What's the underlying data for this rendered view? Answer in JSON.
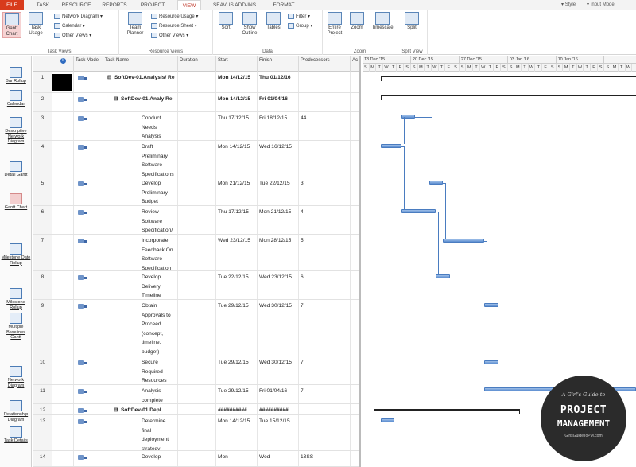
{
  "ribbon": {
    "tabs": [
      "FILE",
      "TASK",
      "RESOURCE",
      "REPORTS",
      "PROJECT",
      "VIEW",
      "SEAVUS ADD-INS",
      "FORMAT"
    ],
    "right": {
      "style": "Style",
      "input_mode": "Input Mode"
    },
    "task_views": {
      "label": "Task Views",
      "gantt": "Gantt Chart",
      "usage": "Task Usage",
      "network": "Network Diagram",
      "calendar": "Calendar",
      "other": "Other Views"
    },
    "resource_views": {
      "label": "Resource Views",
      "team": "Team Planner",
      "usage": "Resource Usage",
      "sheet": "Resource Sheet",
      "other": "Other Views"
    },
    "data": {
      "label": "Data",
      "sort": "Sort",
      "outline": "Show Outline",
      "tables": "Tables",
      "filter": "Filter",
      "group": "Group"
    },
    "zoom": {
      "label": "Zoom",
      "entire": "Entire Project",
      "zoom": "Zoom",
      "timescale": "Timescale"
    },
    "split": {
      "label": "Split View",
      "split": "Split"
    }
  },
  "viewbar": [
    {
      "label": "Bar Rollup",
      "icon": "bar-rollup-icon",
      "selected": false
    },
    {
      "label": "Calendar",
      "icon": "calendar-icon",
      "selected": false
    },
    {
      "label": "Descriptive Network Diagram",
      "icon": "network-diagram-icon",
      "selected": false
    },
    {
      "label": "Detail Gantt",
      "icon": "detail-gantt-icon",
      "selected": false
    },
    {
      "label": "Gantt Chart",
      "icon": "gantt-chart-icon",
      "selected": true
    },
    {
      "label": "Milestone Date Rollup",
      "icon": "milestone-date-icon",
      "selected": false
    },
    {
      "label": "Milestone Rollup",
      "icon": "milestone-rollup-icon",
      "selected": false
    },
    {
      "label": "Multiple Baselines Gantt",
      "icon": "baselines-gantt-icon",
      "selected": false
    },
    {
      "label": "Network Diagram",
      "icon": "network-icon",
      "selected": false
    },
    {
      "label": "Relationship Diagram",
      "icon": "relationship-icon",
      "selected": false
    },
    {
      "label": "Task Details",
      "icon": "task-details-icon",
      "selected": false
    }
  ],
  "table": {
    "columns": [
      "",
      "Task Mode",
      "Task Name",
      "Duration",
      "Start",
      "Finish",
      "Predecessors",
      "Ac"
    ],
    "rows": [
      {
        "id": "1",
        "name": "SoftDev-01.Analysis/ Re",
        "duration": "",
        "start": "Mon 14/12/15",
        "finish": "Thu 01/12/16",
        "pred": "",
        "level": 0,
        "summary": true
      },
      {
        "id": "2",
        "name": "SoftDev-01.Analy Re",
        "duration": "",
        "start": "Mon 14/12/15",
        "finish": "Fri 01/04/16",
        "pred": "",
        "level": 1,
        "summary": true
      },
      {
        "id": "3",
        "name": "Conduct Needs Analysis",
        "duration": "",
        "start": "Thu 17/12/15",
        "finish": "Fri 18/12/15",
        "pred": "44",
        "level": 2,
        "summary": false
      },
      {
        "id": "4",
        "name": "Draft Preliminary Software Specifications",
        "duration": "",
        "start": "Mon 14/12/15",
        "finish": "Wed 16/12/15",
        "pred": "",
        "level": 2,
        "summary": false
      },
      {
        "id": "5",
        "name": "Develop Preliminary Budget",
        "duration": "",
        "start": "Mon 21/12/15",
        "finish": "Tue 22/12/15",
        "pred": "3",
        "level": 2,
        "summary": false
      },
      {
        "id": "6",
        "name": "Review Software Specification/",
        "duration": "",
        "start": "Thu 17/12/15",
        "finish": "Mon 21/12/15",
        "pred": "4",
        "level": 2,
        "summary": false
      },
      {
        "id": "7",
        "name": "Incorporate Feedback On Software Specification",
        "duration": "",
        "start": "Wed 23/12/15",
        "finish": "Mon 28/12/15",
        "pred": "5",
        "level": 2,
        "summary": false
      },
      {
        "id": "8",
        "name": "Develop Delivery Timeline",
        "duration": "",
        "start": "Tue 22/12/15",
        "finish": "Wed 23/12/15",
        "pred": "6",
        "level": 2,
        "summary": false
      },
      {
        "id": "9",
        "name": "Obtain Approvals to Proceed (concept, timeline, budget)",
        "duration": "",
        "start": "Tue 29/12/15",
        "finish": "Wed 30/12/15",
        "pred": "7",
        "level": 2,
        "summary": false
      },
      {
        "id": "10",
        "name": "Secure Required Resources",
        "duration": "",
        "start": "Tue 29/12/15",
        "finish": "Wed 30/12/15",
        "pred": "7",
        "level": 2,
        "summary": false
      },
      {
        "id": "11",
        "name": "Analysis complete",
        "duration": "",
        "start": "Tue 29/12/15",
        "finish": "Fri 01/04/16",
        "pred": "7",
        "level": 2,
        "summary": false
      },
      {
        "id": "12",
        "name": "SoftDev-01.Depl",
        "duration": "",
        "start": "##########",
        "finish": "##########",
        "pred": "",
        "level": 1,
        "summary": true
      },
      {
        "id": "13",
        "name": "Determine final deployment strategy",
        "duration": "",
        "start": "Mon 14/12/15",
        "finish": "Tue 15/12/15",
        "pred": "",
        "level": 2,
        "summary": false
      },
      {
        "id": "14",
        "name": "Develop",
        "duration": "",
        "start": "Mon",
        "finish": "Wed",
        "pred": "13SS",
        "level": 2,
        "summary": false
      }
    ]
  },
  "gantt": {
    "weeks": [
      "13 Dec '15",
      "20 Dec '15",
      "27 Dec '15",
      "03 Jan '16",
      "10 Jan '16"
    ],
    "days": [
      "S",
      "M",
      "T",
      "W",
      "T",
      "F",
      "S",
      "S",
      "M",
      "T",
      "W",
      "T",
      "F",
      "S",
      "S",
      "M",
      "T",
      "W",
      "T",
      "F",
      "S",
      "S",
      "M",
      "T",
      "W",
      "T",
      "F",
      "S",
      "S",
      "M",
      "T",
      "W",
      "T",
      "F",
      "S",
      "S",
      "M",
      "T",
      "W"
    ]
  },
  "logo": {
    "line1": "A Girl's Guide to",
    "line2": "PROJECT",
    "line3": "MANAGEMENT",
    "line4": "GirlsGuideToPM.com"
  }
}
